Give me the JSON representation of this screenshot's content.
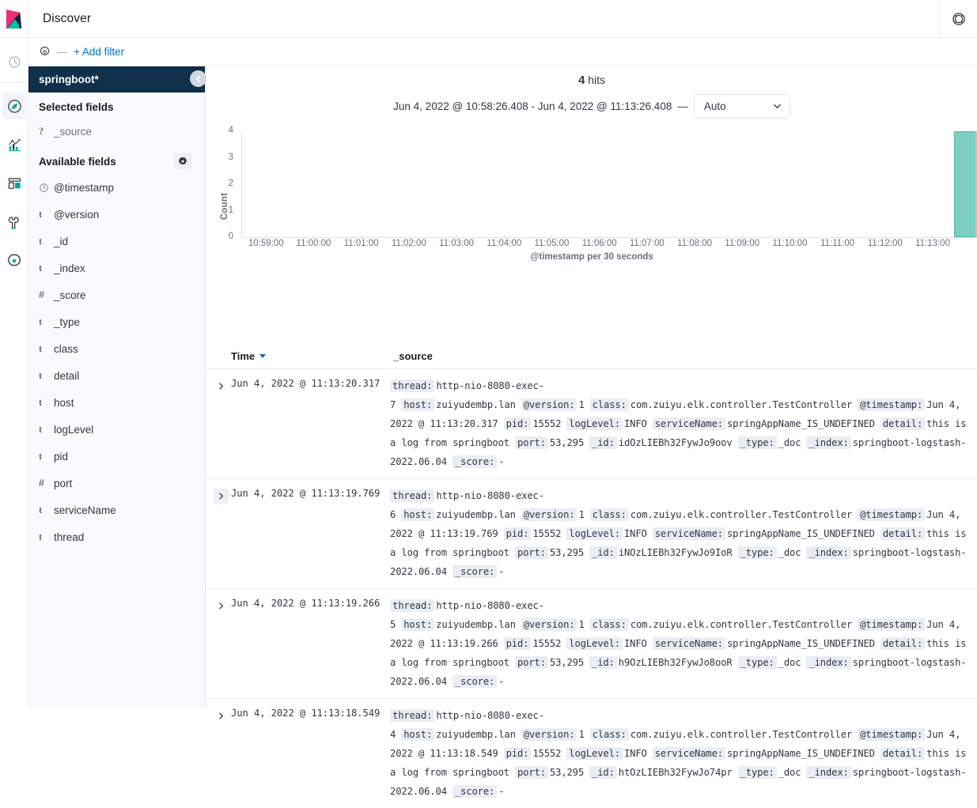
{
  "header": {
    "app_title": "Discover",
    "logo_icon": "kibana-logo",
    "help_icon": "help-circle-icon"
  },
  "navrail": {
    "items": [
      {
        "icon": "clock-icon",
        "name": "recently-viewed",
        "active": false
      },
      {
        "icon": "compass-icon",
        "name": "discover",
        "active": true
      },
      {
        "icon": "bar-chart-icon",
        "name": "visualize",
        "active": false
      },
      {
        "icon": "dashboard-icon",
        "name": "dashboard",
        "active": false
      },
      {
        "icon": "wrench-icon",
        "name": "dev-tools",
        "active": false
      },
      {
        "icon": "gear-icon",
        "name": "management",
        "active": false
      }
    ]
  },
  "filterbar": {
    "gear_icon": "gear-icon",
    "separator": "—",
    "add_filter_label": "+ Add filter"
  },
  "sidebar": {
    "index_pattern": "springboot*",
    "collapse_icon": "chevron-left-icon",
    "selected_fields_label": "Selected fields",
    "selected_fields": [
      {
        "type": "?",
        "name": "_source"
      }
    ],
    "available_fields_label": "Available fields",
    "settings_icon": "gear-icon",
    "available_fields": [
      {
        "type": "clock",
        "name": "@timestamp"
      },
      {
        "type": "t",
        "name": "@version"
      },
      {
        "type": "t",
        "name": "_id"
      },
      {
        "type": "t",
        "name": "_index"
      },
      {
        "type": "#",
        "name": "_score"
      },
      {
        "type": "t",
        "name": "_type"
      },
      {
        "type": "t",
        "name": "class"
      },
      {
        "type": "t",
        "name": "detail"
      },
      {
        "type": "t",
        "name": "host"
      },
      {
        "type": "t",
        "name": "logLevel"
      },
      {
        "type": "t",
        "name": "pid"
      },
      {
        "type": "#",
        "name": "port"
      },
      {
        "type": "t",
        "name": "serviceName"
      },
      {
        "type": "t",
        "name": "thread"
      }
    ]
  },
  "main": {
    "hits_count": "4",
    "hits_label": "hits",
    "time_range": "Jun 4, 2022 @ 10:58:26.408 - Jun 4, 2022 @ 11:13:26.408",
    "range_separator": "—",
    "interval_value": "Auto",
    "interval_chevron": "chevron-down-icon"
  },
  "chart_data": {
    "type": "bar",
    "title": "",
    "xlabel": "@timestamp per 30 seconds",
    "ylabel": "Count",
    "ylim": [
      0,
      4
    ],
    "yticks": [
      0,
      1,
      2,
      3,
      4
    ],
    "grid": false,
    "legend": "none",
    "xticks": [
      "10:59:00",
      "11:00:00",
      "11:01:00",
      "11:02:00",
      "11:03:00",
      "11:04:00",
      "11:05:00",
      "11:06:00",
      "11:07:00",
      "11:08:00",
      "11:09:00",
      "11:10:00",
      "11:11:00",
      "11:12:00",
      "11:13:00"
    ],
    "bar_color": "#7ccfc0",
    "bar_border_color": "#4fb6a3",
    "now_marker_color": "#f3b0b5",
    "categories": [
      "10:58:30",
      "10:59:00",
      "10:59:30",
      "11:00:00",
      "11:00:30",
      "11:01:00",
      "11:01:30",
      "11:02:00",
      "11:02:30",
      "11:03:00",
      "11:03:30",
      "11:04:00",
      "11:04:30",
      "11:05:00",
      "11:05:30",
      "11:06:00",
      "11:06:30",
      "11:07:00",
      "11:07:30",
      "11:08:00",
      "11:08:30",
      "11:09:00",
      "11:09:30",
      "11:10:00",
      "11:10:30",
      "11:11:00",
      "11:11:30",
      "11:12:00",
      "11:12:30",
      "11:13:00"
    ],
    "values": [
      0,
      0,
      0,
      0,
      0,
      0,
      0,
      0,
      0,
      0,
      0,
      0,
      0,
      0,
      0,
      0,
      0,
      0,
      0,
      0,
      0,
      0,
      0,
      0,
      0,
      0,
      0,
      0,
      0,
      4
    ]
  },
  "table": {
    "columns": [
      "Time",
      "_source"
    ],
    "sort_icon": "sort-desc-caret",
    "expand_icon": "chevron-right-icon",
    "rows": [
      {
        "time": "Jun 4, 2022 @ 11:13:20.317",
        "expanded_hover": false,
        "pairs": [
          {
            "key": "thread:",
            "value": "http-nio-8080-exec-7"
          },
          {
            "key": "host:",
            "value": "zuiyudembp.lan"
          },
          {
            "key": "@version:",
            "value": "1"
          },
          {
            "key": "class:",
            "value": "com.zuiyu.elk.controller.TestController"
          },
          {
            "key": "@timestamp:",
            "value": "Jun 4, 2022 @ 11:13:20.317"
          },
          {
            "key": "pid:",
            "value": "15552"
          },
          {
            "key": "logLevel:",
            "value": "INFO"
          },
          {
            "key": "serviceName:",
            "value": "springAppName_IS_UNDEFINED"
          },
          {
            "key": "detail:",
            "value": "this is a log from springboot"
          },
          {
            "key": "port:",
            "value": "53,295"
          },
          {
            "key": "_id:",
            "value": "idOzLIEBh32FywJo9oov"
          },
          {
            "key": "_type:",
            "value": "_doc"
          },
          {
            "key": "_index:",
            "value": "springboot-logstash-2022.06.04"
          },
          {
            "key": "_score:",
            "value": "-"
          }
        ]
      },
      {
        "time": "Jun 4, 2022 @ 11:13:19.769",
        "expanded_hover": true,
        "pairs": [
          {
            "key": "thread:",
            "value": "http-nio-8080-exec-6"
          },
          {
            "key": "host:",
            "value": "zuiyudembp.lan"
          },
          {
            "key": "@version:",
            "value": "1"
          },
          {
            "key": "class:",
            "value": "com.zuiyu.elk.controller.TestController"
          },
          {
            "key": "@timestamp:",
            "value": "Jun 4, 2022 @ 11:13:19.769"
          },
          {
            "key": "pid:",
            "value": "15552"
          },
          {
            "key": "logLevel:",
            "value": "INFO"
          },
          {
            "key": "serviceName:",
            "value": "springAppName_IS_UNDEFINED"
          },
          {
            "key": "detail:",
            "value": "this is a log from springboot"
          },
          {
            "key": "port:",
            "value": "53,295"
          },
          {
            "key": "_id:",
            "value": "iNOzLIEBh32FywJo9IoR"
          },
          {
            "key": "_type:",
            "value": "_doc"
          },
          {
            "key": "_index:",
            "value": "springboot-logstash-2022.06.04"
          },
          {
            "key": "_score:",
            "value": "-"
          }
        ]
      },
      {
        "time": "Jun 4, 2022 @ 11:13:19.266",
        "expanded_hover": false,
        "pairs": [
          {
            "key": "thread:",
            "value": "http-nio-8080-exec-5"
          },
          {
            "key": "host:",
            "value": "zuiyudembp.lan"
          },
          {
            "key": "@version:",
            "value": "1"
          },
          {
            "key": "class:",
            "value": "com.zuiyu.elk.controller.TestController"
          },
          {
            "key": "@timestamp:",
            "value": "Jun 4, 2022 @ 11:13:19.266"
          },
          {
            "key": "pid:",
            "value": "15552"
          },
          {
            "key": "logLevel:",
            "value": "INFO"
          },
          {
            "key": "serviceName:",
            "value": "springAppName_IS_UNDEFINED"
          },
          {
            "key": "detail:",
            "value": "this is a log from springboot"
          },
          {
            "key": "port:",
            "value": "53,295"
          },
          {
            "key": "_id:",
            "value": "h9OzLIEBh32FywJo8ooR"
          },
          {
            "key": "_type:",
            "value": "_doc"
          },
          {
            "key": "_index:",
            "value": "springboot-logstash-2022.06.04"
          },
          {
            "key": "_score:",
            "value": "-"
          }
        ]
      },
      {
        "time": "Jun 4, 2022 @ 11:13:18.549",
        "expanded_hover": false,
        "pairs": [
          {
            "key": "thread:",
            "value": "http-nio-8080-exec-4"
          },
          {
            "key": "host:",
            "value": "zuiyudembp.lan"
          },
          {
            "key": "@version:",
            "value": "1"
          },
          {
            "key": "class:",
            "value": "com.zuiyu.elk.controller.TestController"
          },
          {
            "key": "@timestamp:",
            "value": "Jun 4, 2022 @ 11:13:18.549"
          },
          {
            "key": "pid:",
            "value": "15552"
          },
          {
            "key": "logLevel:",
            "value": "INFO"
          },
          {
            "key": "serviceName:",
            "value": "springAppName_IS_UNDEFINED"
          },
          {
            "key": "detail:",
            "value": "this is a log from springboot"
          },
          {
            "key": "port:",
            "value": "53,295"
          },
          {
            "key": "_id:",
            "value": "htOzLIEBh32FywJo74pr"
          },
          {
            "key": "_type:",
            "value": "_doc"
          },
          {
            "key": "_index:",
            "value": "springboot-logstash-2022.06.04"
          },
          {
            "key": "_score:",
            "value": "-"
          }
        ]
      }
    ]
  }
}
